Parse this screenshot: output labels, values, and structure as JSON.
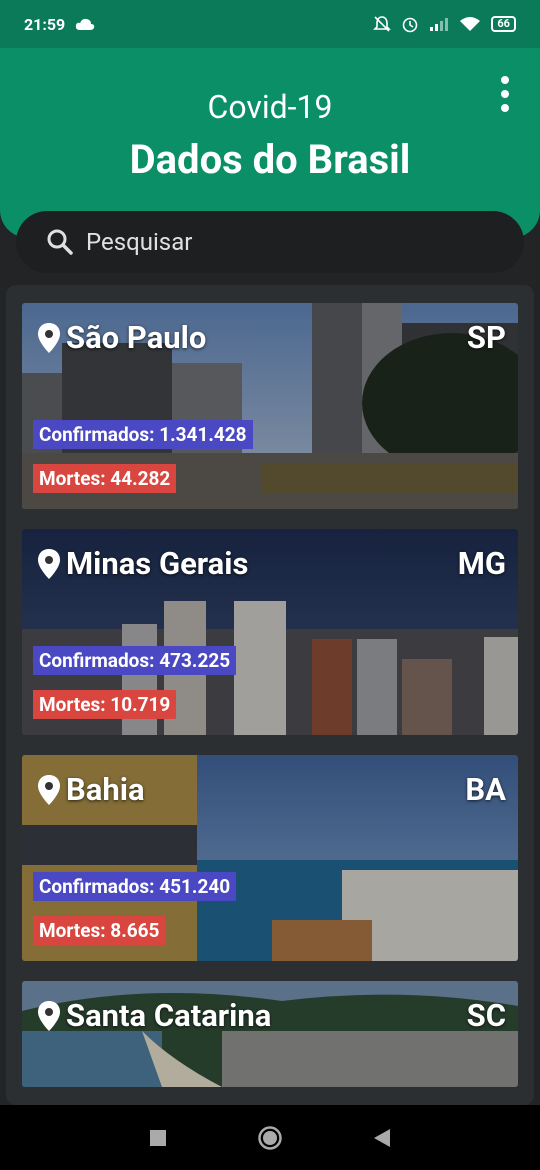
{
  "status_bar": {
    "time": "21:59",
    "battery": "66"
  },
  "header": {
    "subtitle": "Covid-19",
    "title": "Dados do Brasil"
  },
  "search": {
    "placeholder": "Pesquisar"
  },
  "states": [
    {
      "name": "São Paulo",
      "uf": "SP",
      "confirmed": "Confirmados: 1.341.428",
      "deaths": "Mortes: 44.282"
    },
    {
      "name": "Minas Gerais",
      "uf": "MG",
      "confirmed": "Confirmados: 473.225",
      "deaths": "Mortes: 10.719"
    },
    {
      "name": "Bahia",
      "uf": "BA",
      "confirmed": "Confirmados: 451.240",
      "deaths": "Mortes: 8.665"
    },
    {
      "name": "Santa Catarina",
      "uf": "SC"
    }
  ],
  "colors": {
    "header": "#0b8f67",
    "status_bar": "#0b7a59",
    "confirmed_badge": "#4a48c2",
    "deaths_badge": "#d9463f",
    "background": "#222426"
  },
  "icons": {
    "location": "location-pin-icon",
    "search": "search-icon",
    "menu": "more-vert-icon"
  }
}
